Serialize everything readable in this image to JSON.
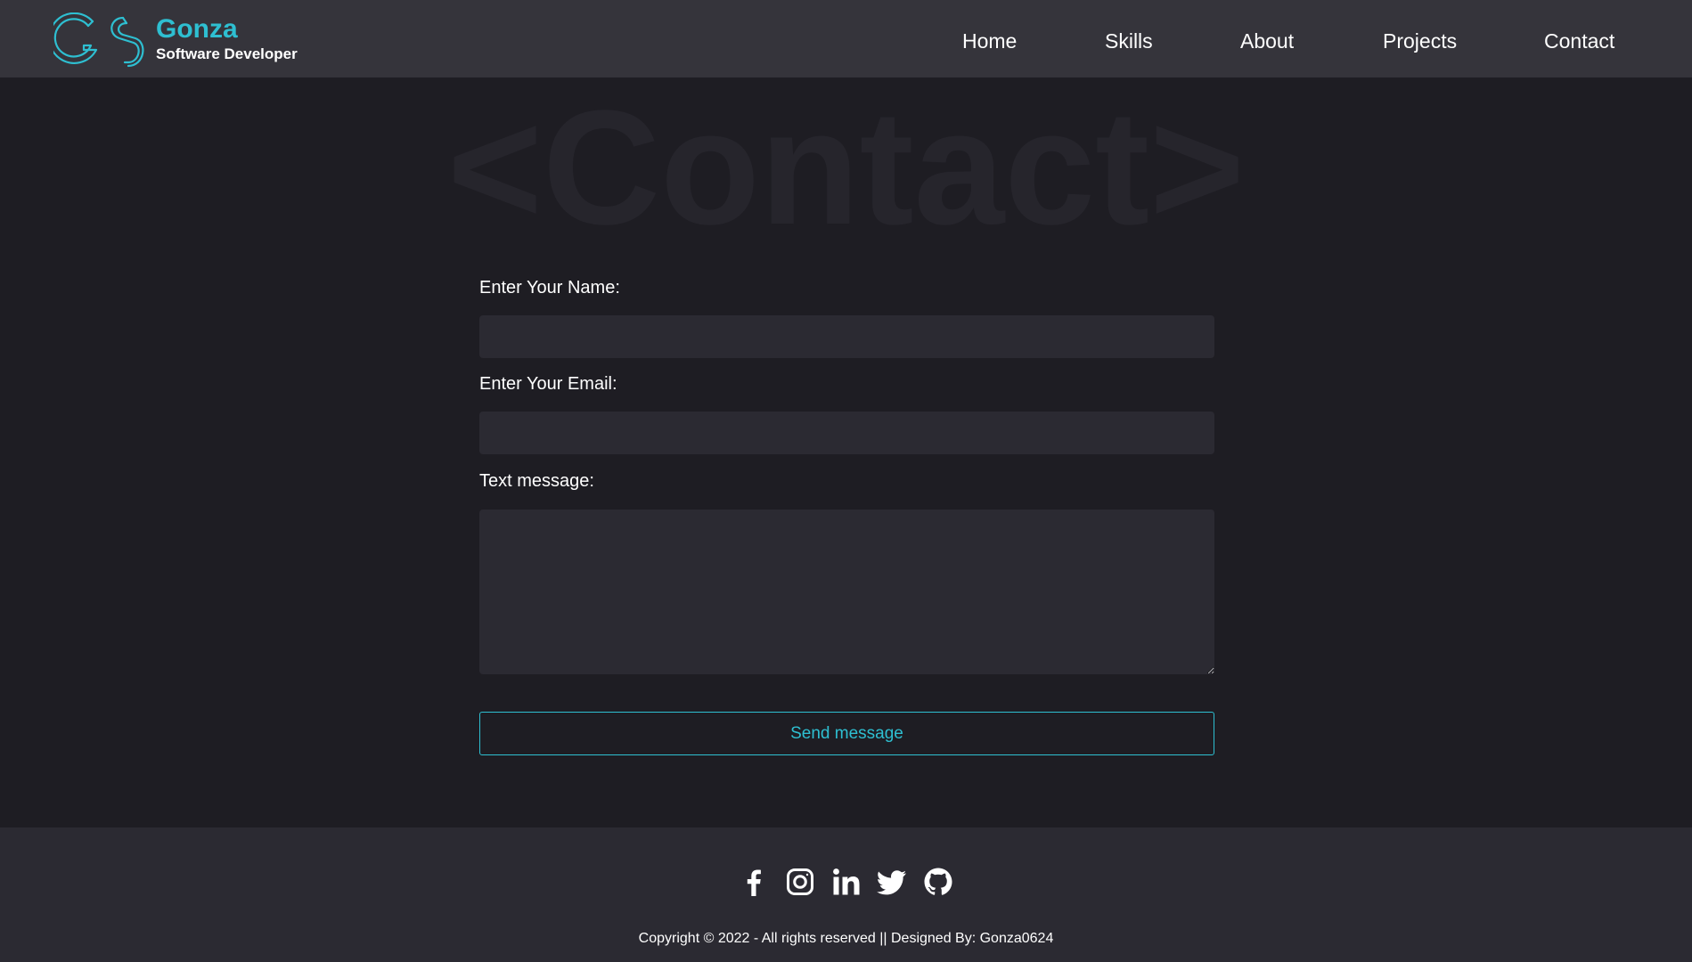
{
  "brand": {
    "name": "Gonza",
    "subtitle": "Software Developer",
    "accent_color": "#2ebfd1"
  },
  "nav": {
    "items": [
      {
        "label": "Home"
      },
      {
        "label": "Skills"
      },
      {
        "label": "About"
      },
      {
        "label": "Projects"
      },
      {
        "label": "Contact"
      }
    ]
  },
  "main": {
    "watermark": "<Contact>",
    "form": {
      "name_label": "Enter Your Name:",
      "name_value": "",
      "email_label": "Enter Your Email:",
      "email_value": "",
      "message_label": "Text message:",
      "message_value": "",
      "submit_label": "Send message"
    }
  },
  "footer": {
    "social_icons": [
      "facebook-icon",
      "instagram-icon",
      "linkedin-icon",
      "twitter-icon",
      "github-icon"
    ],
    "copyright": "Copyright © 2022 - All rights reserved || Designed By: Gonza0624"
  }
}
